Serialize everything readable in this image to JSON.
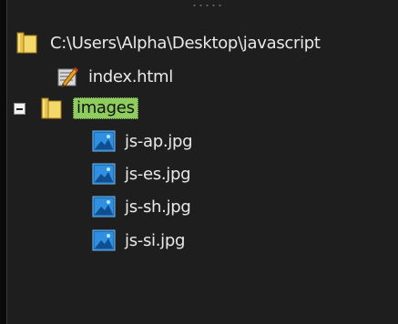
{
  "tree": {
    "root": {
      "label": "C:\\Users\\Alpha\\Desktop\\javascript",
      "icon": "folder-icon"
    },
    "index_file": {
      "label": "index.html",
      "icon": "html-file-icon"
    },
    "images_folder": {
      "label": "images",
      "icon": "folder-icon",
      "expanded": true,
      "selected": true
    },
    "images_children": [
      {
        "label": "js-ap.jpg",
        "icon": "image-file-icon"
      },
      {
        "label": "js-es.jpg",
        "icon": "image-file-icon"
      },
      {
        "label": "js-sh.jpg",
        "icon": "image-file-icon"
      },
      {
        "label": "js-si.jpg",
        "icon": "image-file-icon"
      }
    ]
  },
  "colors": {
    "panel_background": "#1e1e1e",
    "text": "#e9e9e9",
    "selection_highlight": "#8fcc5e",
    "folder": "#e8c24a",
    "image_icon": "#2f8fe0"
  }
}
